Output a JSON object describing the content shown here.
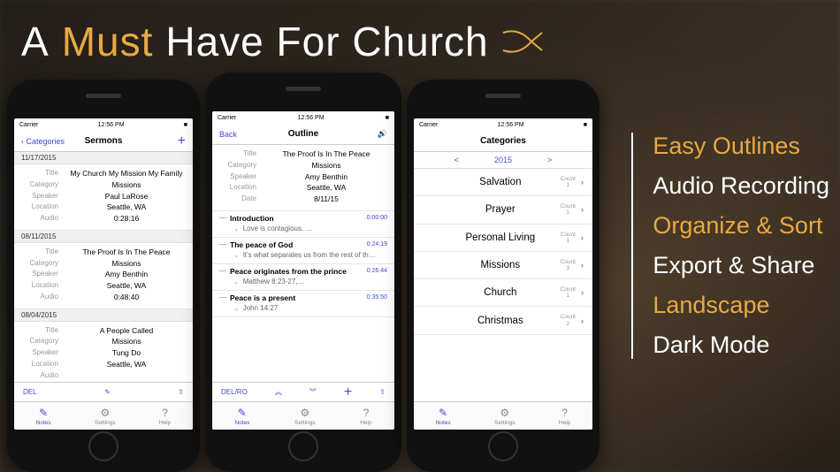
{
  "headline": {
    "a": "A",
    "must": "Must",
    "rest": "Have For Church"
  },
  "statusBar": {
    "carrier": "Carrier",
    "time": "12:56 PM"
  },
  "phone1": {
    "navLeft": "Categories",
    "navTitle": "Sermons",
    "labels": {
      "title": "Title",
      "category": "Category",
      "speaker": "Speaker",
      "location": "Location",
      "audio": "Audio"
    },
    "sermons": [
      {
        "date": "11/17/2015",
        "title": "My Church My Mission My Family",
        "category": "Missions",
        "speaker": "Paul LaRose",
        "location": "Seattle, WA",
        "audio": "0:28:16"
      },
      {
        "date": "08/11/2015",
        "title": "The Proof Is In The Peace",
        "category": "Missions",
        "speaker": "Amy Benthin",
        "location": "Seattle, WA",
        "audio": "0:48:40"
      },
      {
        "date": "08/04/2015",
        "title": "A People Called",
        "category": "Missions",
        "speaker": "Tung Do",
        "location": "Seattle, WA",
        "audio": ""
      }
    ],
    "toolbar": {
      "del": "DEL"
    }
  },
  "phone2": {
    "navLeft": "Back",
    "navTitle": "Outline",
    "labels": {
      "title": "Title",
      "category": "Category",
      "speaker": "Speaker",
      "location": "Location",
      "date": "Date"
    },
    "header": {
      "title": "The Proof Is In The Peace",
      "category": "Missions",
      "speaker": "Amy Benthin",
      "location": "Seattle, WA",
      "date": "8/11/15"
    },
    "sections": [
      {
        "title": "Introduction",
        "time": "0:00:00",
        "sub": "Love is contagious. …"
      },
      {
        "title": "The peace of God",
        "time": "0:24:19",
        "sub": "It's what separates us from the rest of th…"
      },
      {
        "title": "Peace originates from the prince",
        "time": "0:26:44",
        "sub": "Matthew 8:23-27,…"
      },
      {
        "title": "Peace is a present",
        "time": "0:35:50",
        "sub": "John 14:27"
      }
    ],
    "toolbar": {
      "delro": "DEL/RO"
    }
  },
  "phone3": {
    "navTitle": "Categories",
    "yearNav": {
      "prev": "<",
      "year": "2015",
      "next": ">"
    },
    "countLabel": "Count",
    "categories": [
      {
        "name": "Salvation",
        "count": "1"
      },
      {
        "name": "Prayer",
        "count": "1"
      },
      {
        "name": "Personal Living",
        "count": "1"
      },
      {
        "name": "Missions",
        "count": "3"
      },
      {
        "name": "Church",
        "count": "1"
      },
      {
        "name": "Christmas",
        "count": "2"
      }
    ]
  },
  "tabs": {
    "notes": "Notes",
    "settings": "Settings",
    "help": "Help"
  },
  "features": [
    {
      "text": "Easy Outlines",
      "accent": true
    },
    {
      "text": "Audio Recording",
      "accent": false
    },
    {
      "text": "Organize & Sort",
      "accent": true
    },
    {
      "text": "Export & Share",
      "accent": false
    },
    {
      "text": "Landscape",
      "accent": true
    },
    {
      "text": "Dark Mode",
      "accent": false
    }
  ]
}
